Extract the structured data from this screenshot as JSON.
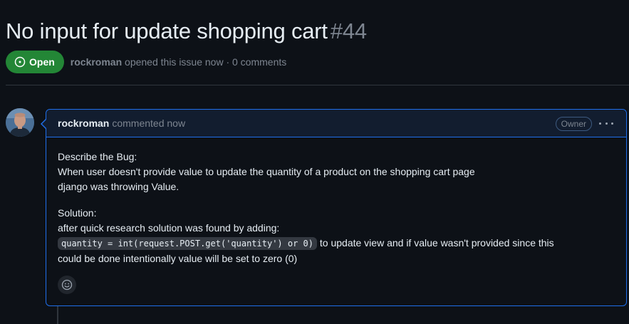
{
  "issue": {
    "title": "No input for update shopping cart",
    "number": "#44",
    "state": "Open",
    "author": "rockroman",
    "meta_text": "opened this issue now · 0 comments"
  },
  "comment": {
    "author": "rockroman",
    "action": "commented now",
    "role_badge": "Owner",
    "body": {
      "line1": "Describe the Bug:",
      "line2": "When user doesn't provide value to update the quantity of a product on the shopping cart page",
      "line3": "django was throwing Value.",
      "line4": "Solution:",
      "line5": "after quick research solution was found by adding:",
      "code": "quantity = int(request.POST.get('quantity') or 0)",
      "line6_after_code": "to update view and if value wasn't provided since this",
      "line7": "could be done intentionally value will be set to zero (0)"
    }
  },
  "icons": {
    "state": "issue-opened-icon",
    "more": "kebab-horizontal-icon",
    "reaction": "smiley-icon"
  },
  "colors": {
    "open_green": "#238636",
    "accent_blue": "#1f6feb",
    "background": "#0d1117",
    "muted_text": "#7d8590"
  }
}
